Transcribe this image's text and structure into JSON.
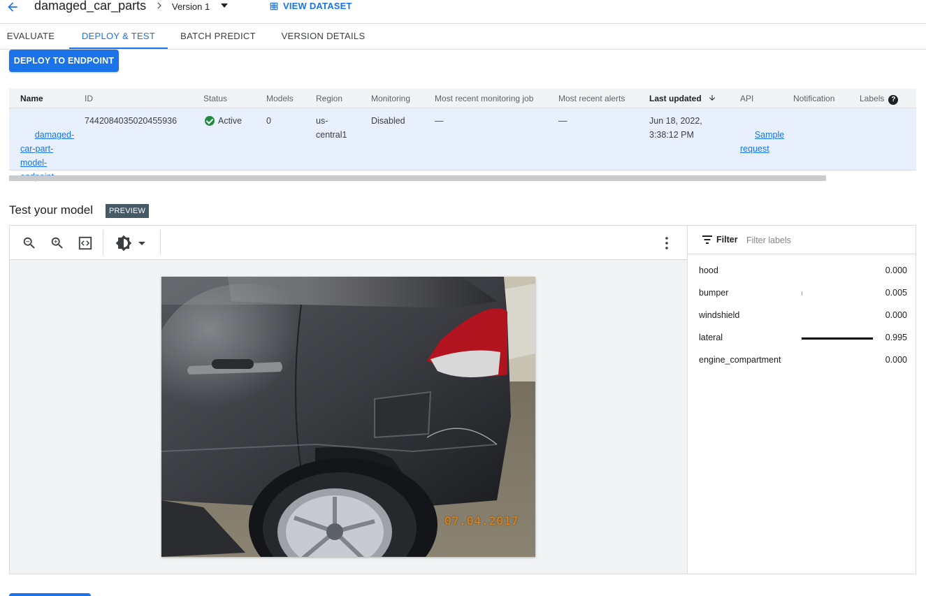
{
  "header": {
    "dataset_title": "damaged_car_parts",
    "version": "Version 1",
    "view_dataset": "VIEW DATASET"
  },
  "tabs": [
    {
      "label": "EVALUATE"
    },
    {
      "label": "DEPLOY & TEST"
    },
    {
      "label": "BATCH PREDICT"
    },
    {
      "label": "VERSION DETAILS"
    }
  ],
  "active_tab": "DEPLOY & TEST",
  "deploy_button": "DEPLOY TO ENDPOINT",
  "endpoints_table": {
    "columns": [
      "Name",
      "ID",
      "Status",
      "Models",
      "Region",
      "Monitoring",
      "Most recent monitoring job",
      "Most recent alerts",
      "Last updated",
      "API",
      "Notification",
      "Labels"
    ],
    "rows": [
      {
        "name": "damaged-\ncar-part-\nmodel-\nendpoint",
        "id": "7442084035020455936",
        "status": "Active",
        "models": "0",
        "region": "us-\ncentral1",
        "monitoring": "Disabled",
        "recent_job": "—",
        "recent_alerts": "—",
        "last_updated": "Jun 18, 2022,\n3:38:12 PM",
        "api": "Sample\nrequest",
        "notification": "",
        "labels": ""
      }
    ]
  },
  "test_section": {
    "title": "Test your model",
    "badge": "PREVIEW"
  },
  "viewer": {
    "tools": [
      "zoom-out-icon",
      "zoom-in-icon",
      "fit-to-screen-icon",
      "brightness-icon",
      "more-vert-icon"
    ],
    "photo_stamp": "07.04.2017"
  },
  "labels_panel": {
    "filter_label": "Filter",
    "filter_placeholder": "Filter labels",
    "predictions": [
      {
        "label": "hood",
        "score": "0.000",
        "value": 0.0
      },
      {
        "label": "bumper",
        "score": "0.005",
        "value": 0.005
      },
      {
        "label": "windshield",
        "score": "0.000",
        "value": 0.0
      },
      {
        "label": "lateral",
        "score": "0.995",
        "value": 0.995
      },
      {
        "label": "engine_compartment",
        "score": "0.000",
        "value": 0.0
      }
    ]
  },
  "colors": {
    "accent": "#1a73e8",
    "selected_row": "#e8f0fe",
    "status_ok": "#1e8e3e",
    "badge": "#455a64"
  }
}
